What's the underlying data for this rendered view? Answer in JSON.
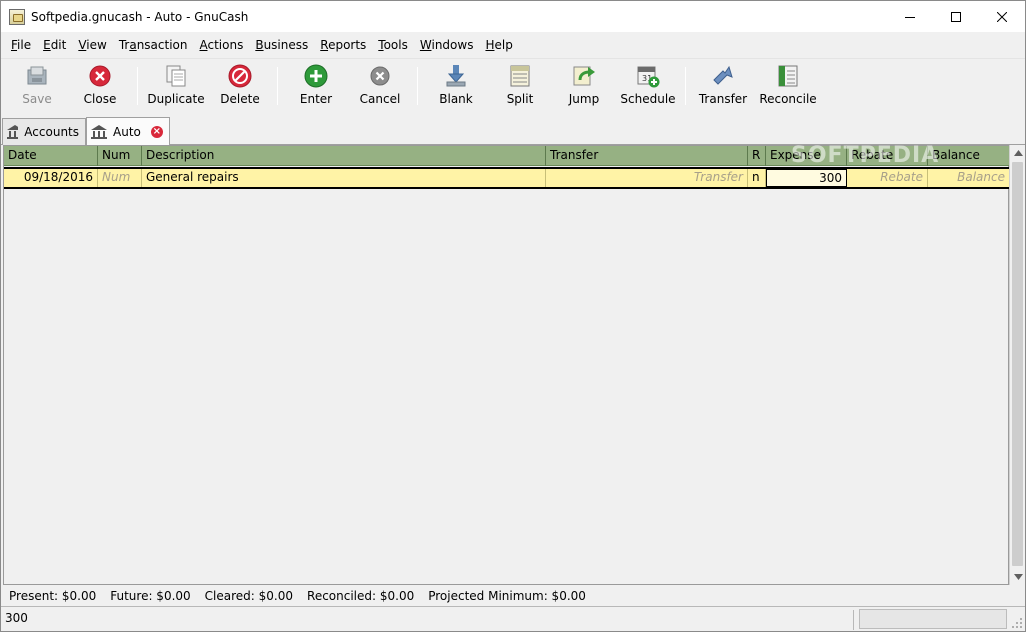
{
  "window": {
    "title": "Softpedia.gnucash - Auto - GnuCash"
  },
  "menu": [
    {
      "pre": "",
      "u": "F",
      "post": "ile"
    },
    {
      "pre": "",
      "u": "E",
      "post": "dit"
    },
    {
      "pre": "",
      "u": "V",
      "post": "iew"
    },
    {
      "pre": "Tr",
      "u": "a",
      "post": "nsaction"
    },
    {
      "pre": "",
      "u": "A",
      "post": "ctions"
    },
    {
      "pre": "",
      "u": "B",
      "post": "usiness"
    },
    {
      "pre": "",
      "u": "R",
      "post": "eports"
    },
    {
      "pre": "",
      "u": "T",
      "post": "ools"
    },
    {
      "pre": "",
      "u": "W",
      "post": "indows"
    },
    {
      "pre": "",
      "u": "H",
      "post": "elp"
    }
  ],
  "toolbar": {
    "save": "Save",
    "close": "Close",
    "duplicate": "Duplicate",
    "delete": "Delete",
    "enter": "Enter",
    "cancel": "Cancel",
    "blank": "Blank",
    "split": "Split",
    "jump": "Jump",
    "schedule": "Schedule",
    "transfer": "Transfer",
    "reconcile": "Reconcile"
  },
  "tabs": [
    {
      "label": "Accounts",
      "active": false
    },
    {
      "label": "Auto",
      "active": true
    }
  ],
  "register": {
    "columns": [
      "Date",
      "Num",
      "Description",
      "Transfer",
      "R",
      "Expense",
      "Rebate",
      "Balance"
    ],
    "row": {
      "date": "09/18/2016",
      "num": "Num",
      "description": "General repairs",
      "transfer": "Transfer",
      "reconciled": "n",
      "expense": "300",
      "rebate": "Rebate",
      "balance": "Balance"
    }
  },
  "watermark": "SOFTPEDIA",
  "summary": {
    "present": "Present: $0.00",
    "future": "Future: $0.00",
    "cleared": "Cleared: $0.00",
    "reconciled": "Reconciled: $0.00",
    "projected_minimum": "Projected Minimum: $0.00"
  },
  "status": {
    "text": "300"
  },
  "colors": {
    "header_bg": "#96b183",
    "row_bg": "#fff3a6",
    "hint_text": "#a8a08a"
  }
}
